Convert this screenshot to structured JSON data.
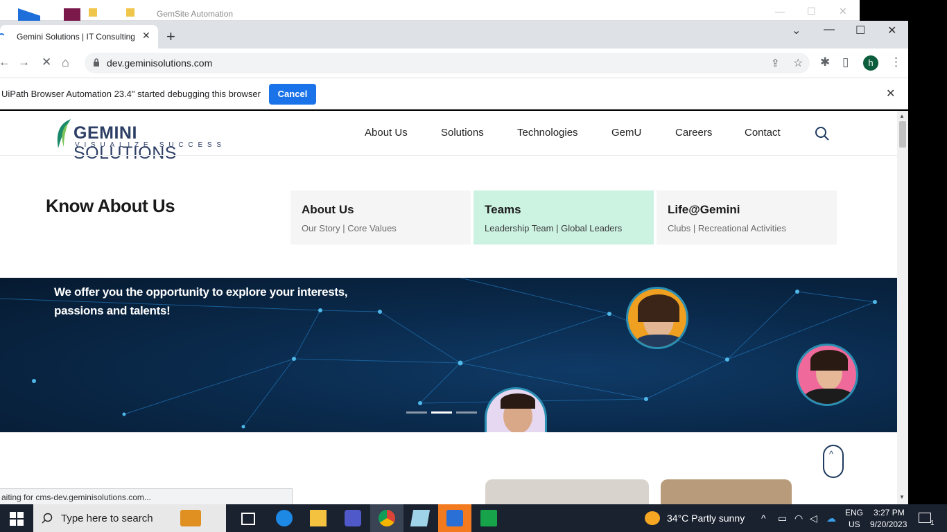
{
  "background_window": {
    "title": "GemSite Automation"
  },
  "browser": {
    "tab_title": "Gemini Solutions | IT Consulting",
    "url": "dev.geminisolutions.com",
    "avatar_letter": "h",
    "infobar_message": "UiPath Browser Automation 23.4\" started debugging this browser",
    "cancel_label": "Cancel",
    "status_text": "aiting for cms-dev.geminisolutions.com..."
  },
  "site": {
    "logo_name": "GEMINI",
    "logo_name2": "SOLUTIONS",
    "logo_tagline": "VISUALIZE SUCCESS",
    "nav": [
      "About Us",
      "Solutions",
      "Technologies",
      "GemU",
      "Careers",
      "Contact"
    ],
    "dropdown_title": "Know About Us",
    "cards": [
      {
        "title": "About Us",
        "subtitle": "Our Story | Core Values"
      },
      {
        "title": "Teams",
        "subtitle": "Leadership Team | Global Leaders"
      },
      {
        "title": "Life@Gemini",
        "subtitle": "Clubs | Recreational Activities"
      }
    ],
    "hero_text": "We offer you the opportunity to explore your interests, passions and talents!",
    "carousel_active_index": 1
  },
  "taskbar": {
    "search_placeholder": "Type here to search",
    "weather": "34°C  Partly sunny",
    "lang": "ENG",
    "region": "US",
    "time": "3:27 PM",
    "date": "9/20/2023",
    "notification_count": "1"
  }
}
